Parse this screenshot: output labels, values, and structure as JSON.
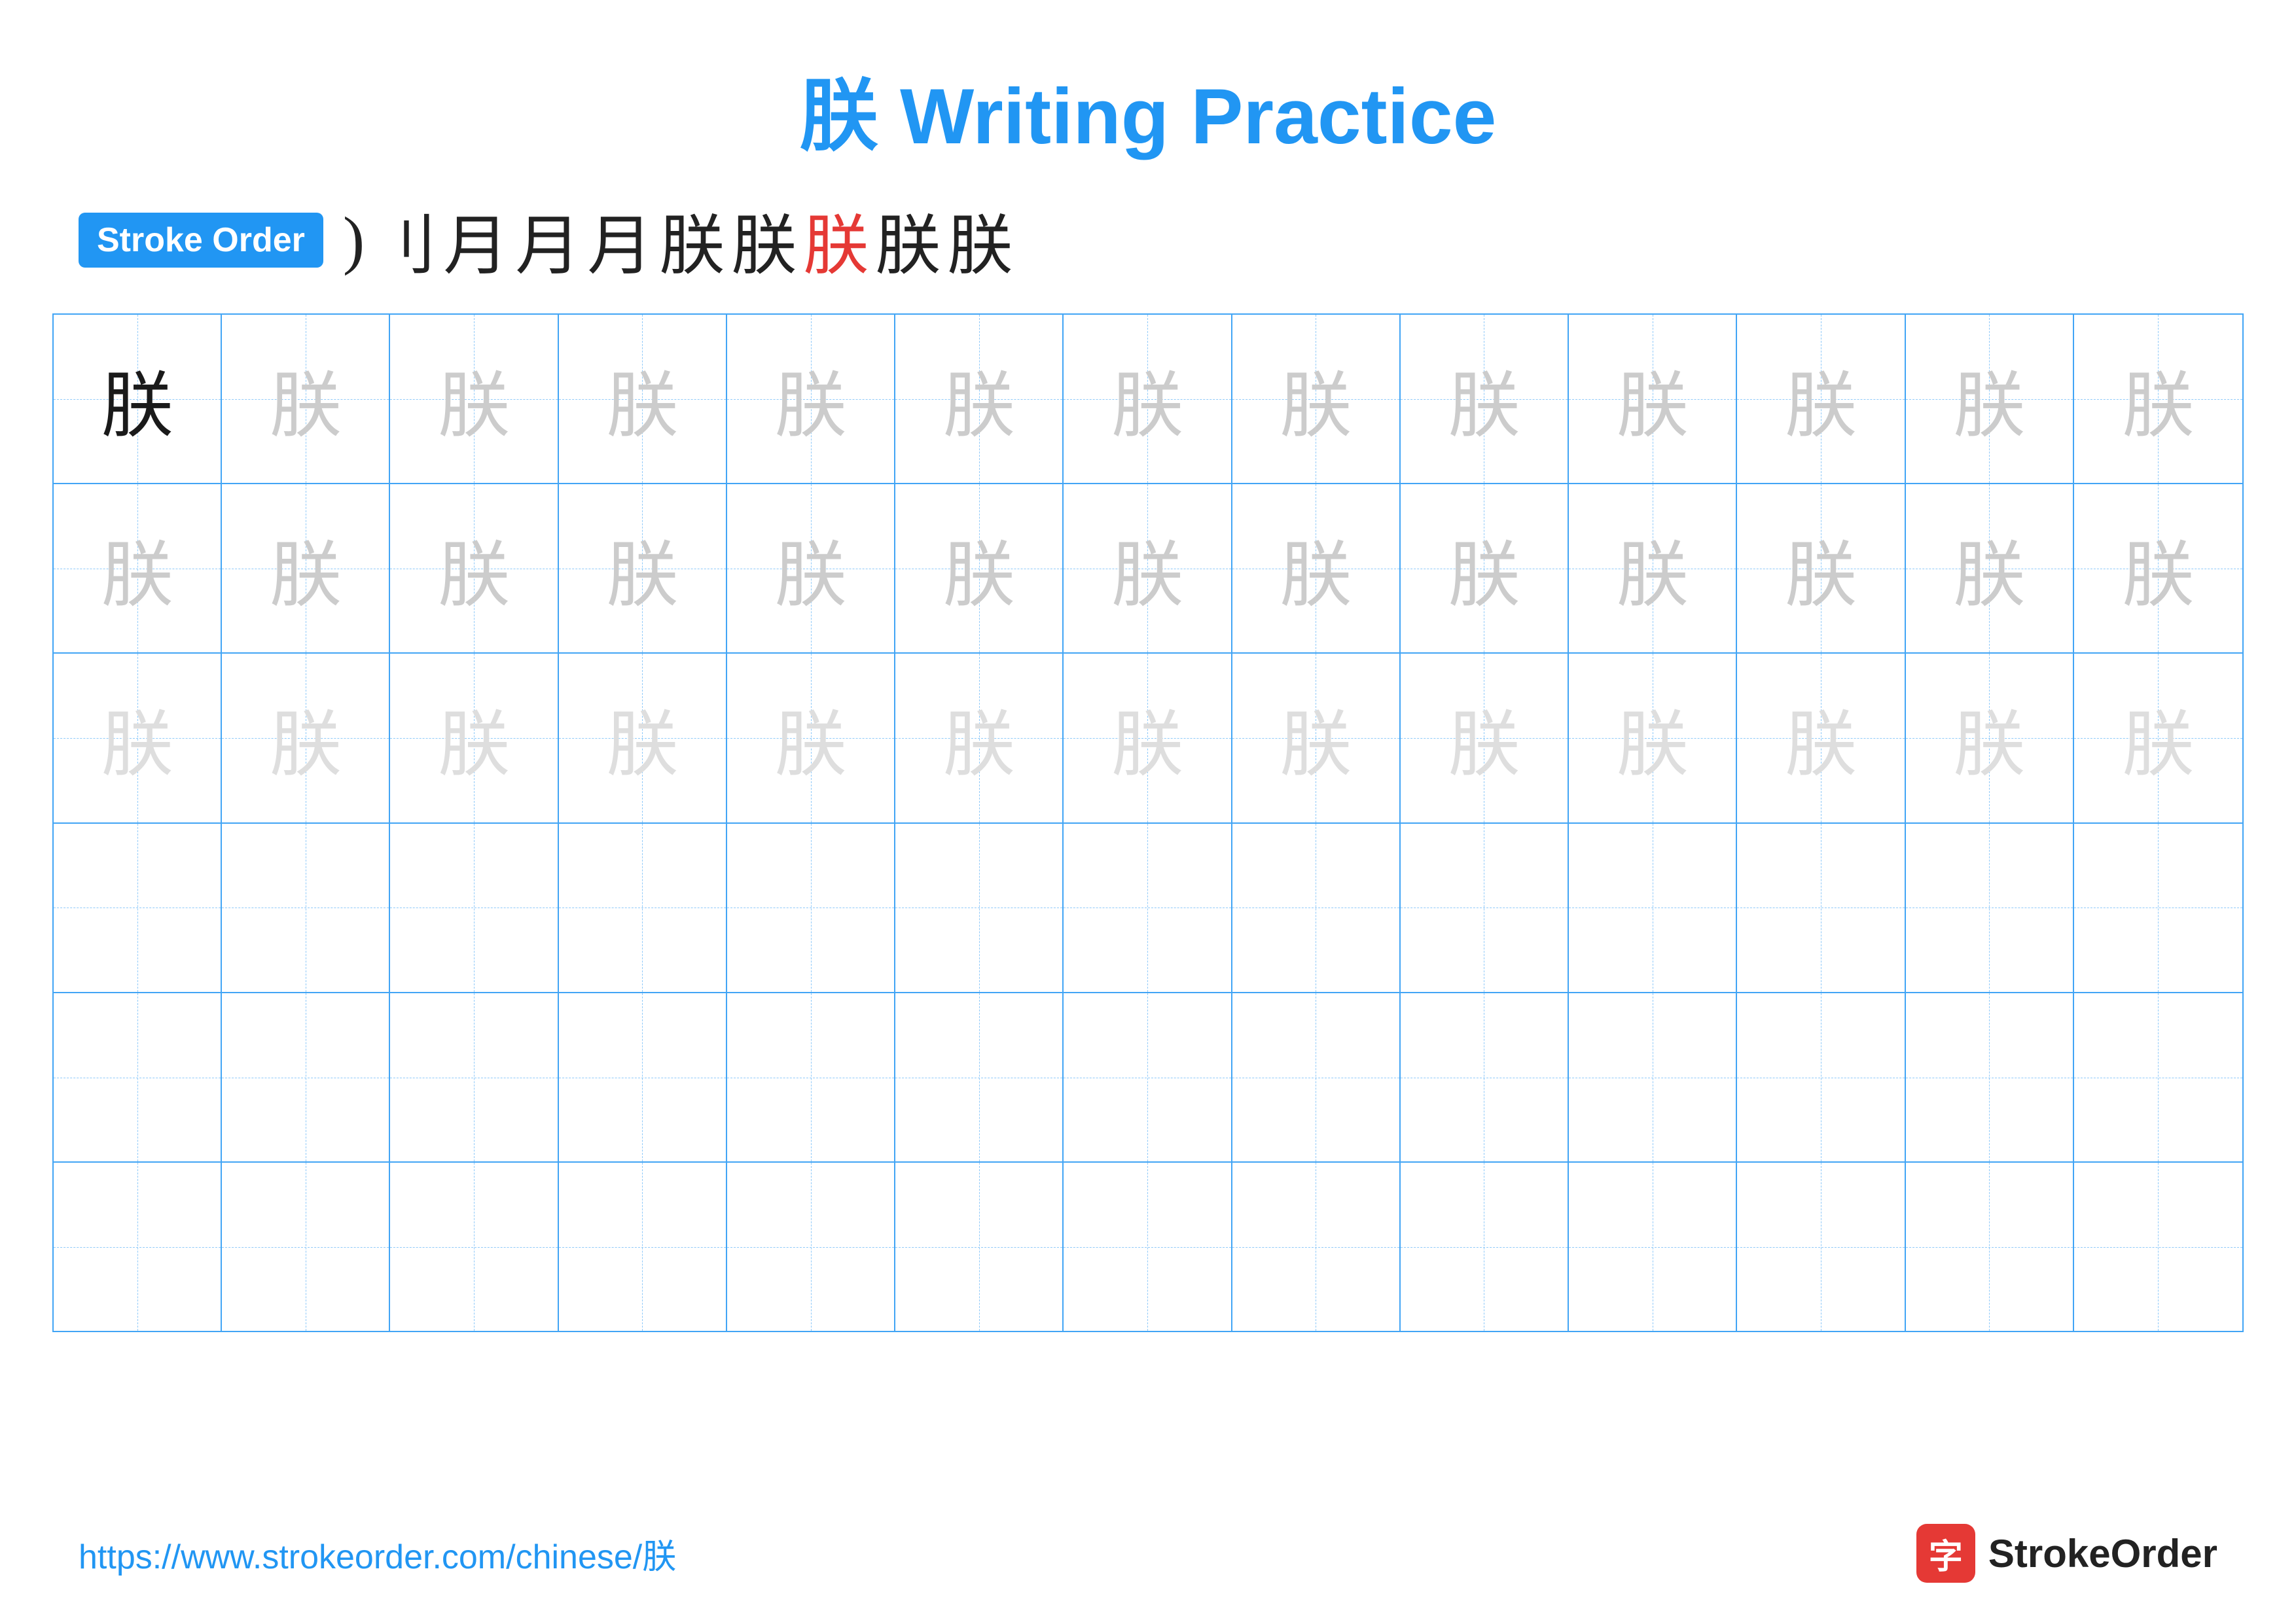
{
  "title": {
    "char": "朕",
    "text": " Writing Practice"
  },
  "stroke_order": {
    "badge_label": "Stroke Order",
    "strokes": [
      ")",
      "刂",
      "月",
      "月",
      "月",
      "朕",
      "朕",
      "朕",
      "朕",
      "朕"
    ],
    "red_index": 7
  },
  "grid": {
    "character": "朕",
    "rows": 6,
    "cols": 13,
    "filled_rows": [
      {
        "type": "dark_then_light",
        "dark_count": 1
      },
      {
        "type": "all_light"
      },
      {
        "type": "all_lighter"
      },
      {
        "type": "empty"
      },
      {
        "type": "empty"
      },
      {
        "type": "empty"
      }
    ]
  },
  "footer": {
    "url": "https://www.strokeorder.com/chinese/朕",
    "logo_char": "字",
    "logo_text": "StrokeOrder"
  }
}
